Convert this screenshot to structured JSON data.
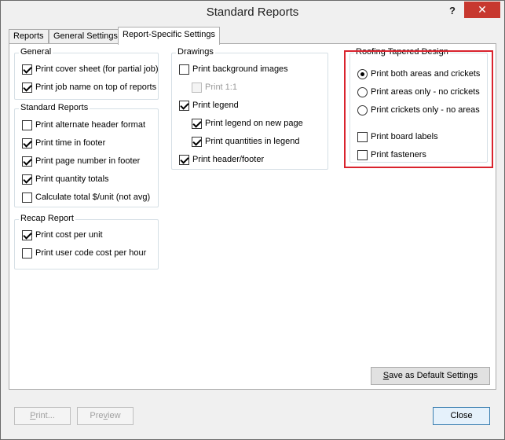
{
  "window": {
    "title": "Standard Reports",
    "help": "?",
    "close": "✕"
  },
  "tabs": [
    {
      "label": "Reports"
    },
    {
      "label": "General Settings"
    },
    {
      "label": "Report-Specific Settings",
      "active": true
    }
  ],
  "general": {
    "label": "General",
    "items": [
      {
        "label": "Print cover sheet (for partial job)",
        "checked": true
      },
      {
        "label": "Print job name on top of reports",
        "checked": true
      }
    ]
  },
  "standard_reports": {
    "label": "Standard Reports",
    "items": [
      {
        "label": "Print alternate header format",
        "checked": false
      },
      {
        "label": "Print time in footer",
        "checked": true
      },
      {
        "label": "Print page number in footer",
        "checked": true
      },
      {
        "label": "Print quantity totals",
        "checked": true
      },
      {
        "label": "Calculate total $/unit (not avg)",
        "checked": false
      }
    ]
  },
  "recap_report": {
    "label": "Recap Report",
    "items": [
      {
        "label": "Print cost per unit",
        "checked": true
      },
      {
        "label": "Print user code cost per hour",
        "checked": false
      }
    ]
  },
  "drawings": {
    "label": "Drawings",
    "items": [
      {
        "label": "Print background images",
        "checked": false
      },
      {
        "label": "Print 1:1",
        "checked": false,
        "disabled": true
      },
      {
        "label": "Print legend",
        "checked": true
      },
      {
        "label": "Print legend on new page",
        "checked": true
      },
      {
        "label": "Print quantities in legend",
        "checked": true
      },
      {
        "label": "Print header/footer",
        "checked": true
      }
    ]
  },
  "roofing": {
    "label": "Roofing Tapered Design",
    "radios": [
      {
        "label": "Print both areas and crickets",
        "selected": true
      },
      {
        "label": "Print areas only - no crickets",
        "selected": false
      },
      {
        "label": "Print crickets only - no areas",
        "selected": false
      }
    ],
    "checks": [
      {
        "label": "Print board labels",
        "checked": false
      },
      {
        "label": "Print fasteners",
        "checked": false
      }
    ],
    "highlight_color": "#d9232d"
  },
  "buttons": {
    "save_default_prefix": "S",
    "save_default_rest": "ave as Default Settings",
    "print_prefix": "P",
    "print_rest": "rint...",
    "preview_prefix": "Pre",
    "preview_underline": "v",
    "preview_rest": "iew",
    "close": "Close"
  }
}
